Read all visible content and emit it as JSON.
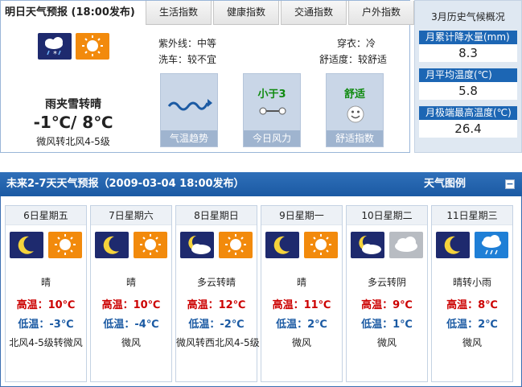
{
  "tomorrow": {
    "title": "明日天气预报",
    "published": "(18:00发布)",
    "condition": "雨夹雪转晴",
    "temp": "-1℃/ 8℃",
    "wind": "微风转北风4-5级",
    "night_icon": "sleet-icon",
    "day_icon": "sun-icon"
  },
  "tabs": [
    "生活指数",
    "健康指数",
    "交通指数",
    "户外指数"
  ],
  "indices": {
    "uv": "紫外线：中等",
    "clothing": "穿衣：冷",
    "carwash": "洗车：较不宜",
    "comfort": "舒适度：较舒适"
  },
  "tiles": [
    {
      "caption": "气温趋势",
      "big": "",
      "icon": "trend-icon"
    },
    {
      "caption": "今日风力",
      "big": "小于3",
      "icon": "wind-icon"
    },
    {
      "caption": "舒适指数",
      "big": "舒适",
      "icon": "smile-icon"
    }
  ],
  "history": {
    "title": "3月历史气候概况",
    "items": [
      {
        "label": "月累计降水量(mm)",
        "value": "8.3"
      },
      {
        "label": "月平均温度(℃)",
        "value": "5.8"
      },
      {
        "label": "月极端最高温度(℃)",
        "value": "26.4"
      }
    ]
  },
  "forecast_bar": {
    "title": "未来2-7天天气预报（2009-03-04 18:00发布）",
    "legend": "天气图例",
    "collapse": "−"
  },
  "days": [
    {
      "date": "6日星期五",
      "desc": "晴",
      "hi_label": "高温：",
      "hi": "10℃",
      "lo_label": "低温：",
      "lo": "-3℃",
      "wind": "北风4-5级转微风",
      "night": "moon-icon",
      "day": "sun-icon"
    },
    {
      "date": "7日星期六",
      "desc": "晴",
      "hi_label": "高温：",
      "hi": "10℃",
      "lo_label": "低温：",
      "lo": "-4℃",
      "wind": "微风",
      "night": "moon-icon",
      "day": "sun-icon"
    },
    {
      "date": "8日星期日",
      "desc": "多云转晴",
      "hi_label": "高温：",
      "hi": "12℃",
      "lo_label": "低温：",
      "lo": "-2℃",
      "wind": "微风转西北风4-5级",
      "night": "moon-cloud-icon",
      "day": "sun-icon"
    },
    {
      "date": "9日星期一",
      "desc": "晴",
      "hi_label": "高温：",
      "hi": "11℃",
      "lo_label": "低温：",
      "lo": "2℃",
      "wind": "微风",
      "night": "moon-icon",
      "day": "sun-icon"
    },
    {
      "date": "10日星期二",
      "desc": "多云转阴",
      "hi_label": "高温：",
      "hi": "9℃",
      "lo_label": "低温：",
      "lo": "1℃",
      "wind": "微风",
      "night": "moon-cloud-icon",
      "day": "overcast-icon"
    },
    {
      "date": "11日星期三",
      "desc": "晴转小雨",
      "hi_label": "高温：",
      "hi": "8℃",
      "lo_label": "低温：",
      "lo": "2℃",
      "wind": "微风",
      "night": "moon-icon",
      "day": "light-rain-icon"
    }
  ]
}
